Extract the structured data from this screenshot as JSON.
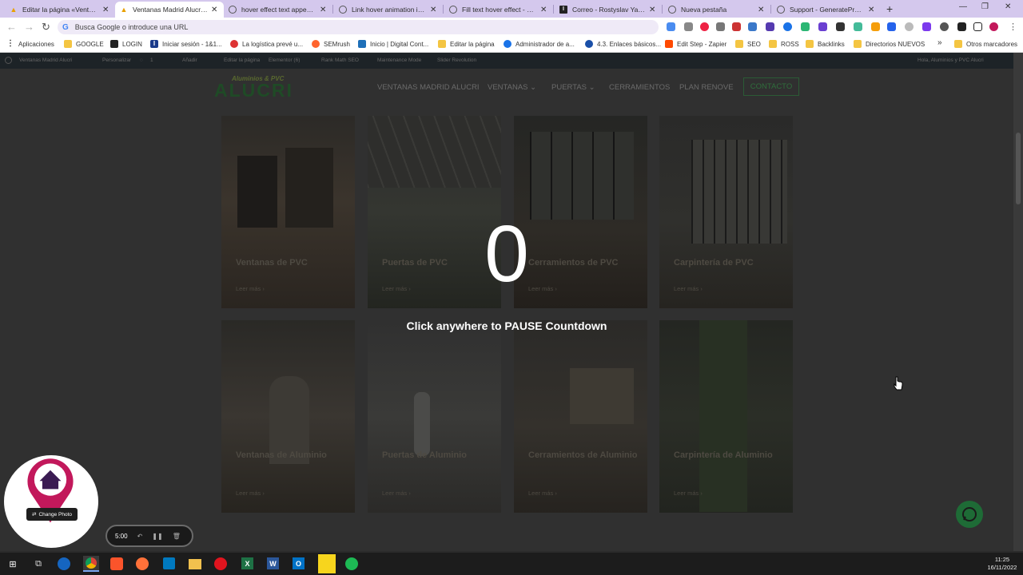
{
  "browser": {
    "tabs": [
      {
        "label": "Editar la página «Ventanas",
        "icon": "wordpress-icon",
        "active": false
      },
      {
        "label": "Ventanas Madrid Alucri | P",
        "icon": "alucri-icon",
        "active": true
      },
      {
        "label": "hover effect text appears o",
        "icon": "google-icon",
        "active": false
      },
      {
        "label": "Link hover animation in te",
        "icon": "google-icon",
        "active": false
      },
      {
        "label": "Fill text hover effect - Gen",
        "icon": "google-icon",
        "active": false
      },
      {
        "label": "Correo - Rostyslav Yatsyny",
        "icon": "mail-icon",
        "active": false
      },
      {
        "label": "Nueva pestaña",
        "icon": "chrome-icon",
        "active": false
      },
      {
        "label": "Support - GeneratePress",
        "icon": "google-icon",
        "active": false
      }
    ],
    "new_tab": "+",
    "omnibox": {
      "placeholder": "Busca Google o introduce una URL"
    },
    "bookmarks": [
      {
        "label": "Aplicaciones"
      },
      {
        "label": "GOOGLE"
      },
      {
        "label": "LOGIN"
      },
      {
        "label": "Iniciar sesión - 1&1..."
      },
      {
        "label": "La logística prevé u..."
      },
      {
        "label": "SEMrush"
      },
      {
        "label": "Inicio | Digital Cont..."
      },
      {
        "label": "Editar la página"
      },
      {
        "label": "Administrador de a..."
      },
      {
        "label": "4.3. Enlaces básicos..."
      },
      {
        "label": "Edit Step - Zapier"
      },
      {
        "label": "SEO"
      },
      {
        "label": "ROSS"
      },
      {
        "label": "Backlinks"
      },
      {
        "label": "Directorios NUEVOS"
      },
      {
        "label": "»"
      },
      {
        "label": "Otros marcadores"
      }
    ]
  },
  "wp_admin": {
    "site": "Ventanas Madrid Alucri",
    "customize": "Personalizar",
    "comments": "1",
    "new": "Añadir",
    "edit": "Editar la página",
    "elementor": "Elementor (6)",
    "rankmath": "Rank Math SEO",
    "maintenance": "Maintenance Mode",
    "slider": "Slider Revolution",
    "greeting": "Hola, Aluminios y PVC Alucri"
  },
  "site": {
    "logo_tagline": "Aluminios & PVC",
    "logo": "ALUCRI",
    "menu": [
      {
        "label": "VENTANAS MADRID ALUCRI"
      },
      {
        "label": "VENTANAS",
        "dropdown": true
      },
      {
        "label": "PUERTAS",
        "dropdown": true
      },
      {
        "label": "CERRAMIENTOS"
      },
      {
        "label": "PLAN RENOVE"
      }
    ],
    "cta": "CONTACTO",
    "cards": [
      {
        "title": "Ventanas de PVC",
        "link": "Leer más"
      },
      {
        "title": "Puertas de PVC",
        "link": "Leer más"
      },
      {
        "title": "Cerramientos de PVC",
        "link": "Leer más"
      },
      {
        "title": "Carpintería de PVC",
        "link": "Leer más"
      },
      {
        "title": "Ventanas de Aluminio",
        "link": "Leer más"
      },
      {
        "title": "Puertas de Aluminio",
        "link": "Leer más"
      },
      {
        "title": "Cerramientos de Aluminio",
        "link": "Leer más"
      },
      {
        "title": "Carpintería de Aluminio",
        "link": "Leer más"
      }
    ]
  },
  "overlay": {
    "countdown": "0",
    "message": "Click anywhere to PAUSE Countdown"
  },
  "recorder": {
    "change_photo": "Change Photo",
    "timer": "5:00"
  },
  "taskbar": {
    "time": "11:25",
    "date": "16/11/2022"
  },
  "colors": {
    "tab_bar": "#d4c8ed",
    "logo_green": "#1f4a26",
    "pin_magenta": "#c2185b",
    "whatsapp_green": "#1e6b36"
  }
}
